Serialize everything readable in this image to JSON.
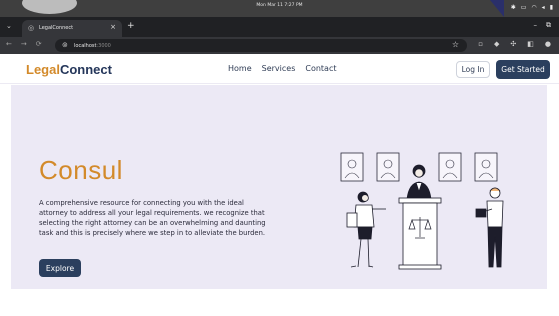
{
  "os": {
    "clock": "Mon Mar 11  7:27 PM",
    "tray_icons": [
      "bluetooth-icon",
      "display-icon",
      "wifi-icon",
      "volume-icon",
      "battery-icon"
    ]
  },
  "browser": {
    "tab": {
      "title": "LegalConnect",
      "favicon": "globe-icon",
      "close": "×"
    },
    "new_tab": "+",
    "window_controls": [
      "–",
      "⧉"
    ],
    "nav_buttons": [
      "←",
      "→",
      "⟳"
    ],
    "url": {
      "host": "localhost",
      "port": ":3000"
    },
    "star": "☆"
  },
  "site": {
    "logo": {
      "part1": "Legal",
      "part2": "Connect"
    },
    "menu": [
      "Home",
      "Services",
      "Contact"
    ],
    "login_label": "Log In",
    "cta_label": "Get Started"
  },
  "hero": {
    "title": "Consul",
    "description": "A comprehensive resource for connecting you with the ideal attorney to address all your legal requirements. we recognize that selecting the right attorney can be an overwhelming and daunting task and this is precisely where we step in to alleviate the burden.",
    "button_label": "Explore"
  },
  "colors": {
    "accent": "#d38a2a",
    "navy": "#2b3f5e",
    "hero_bg": "#ece9f5"
  }
}
